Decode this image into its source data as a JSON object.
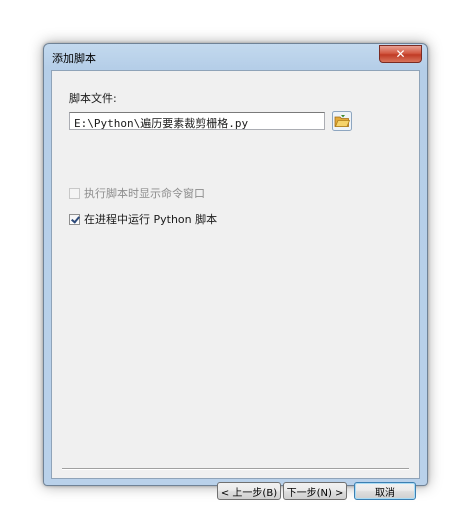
{
  "window": {
    "title": "添加脚本",
    "close_glyph": "✕"
  },
  "form": {
    "script_label": "脚本文件:",
    "script_path": "E:\\Python\\遍历要素裁剪栅格.py",
    "browse_icon": "folder-open-icon",
    "show_cmd_label": "执行脚本时显示命令窗口",
    "show_cmd_checked": false,
    "show_cmd_enabled": false,
    "run_in_process_label": "在进程中运行 Python 脚本",
    "run_in_process_checked": true
  },
  "buttons": {
    "back": "< 上一步(B)",
    "next": "下一步(N) >",
    "cancel": "取消"
  }
}
